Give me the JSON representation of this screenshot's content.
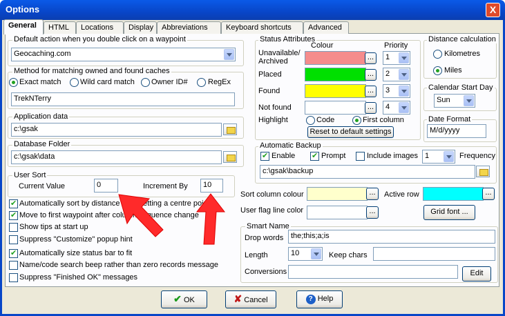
{
  "window": {
    "title": "Options",
    "close": "X"
  },
  "tabs": [
    "General",
    "HTML",
    "Locations",
    "Display",
    "Abbreviations",
    "Keyboard shortcuts",
    "Advanced"
  ],
  "default_action": {
    "label": "Default action when you double click on a waypoint",
    "value": "Geocaching.com"
  },
  "matching": {
    "label": "Method for matching owned and found caches",
    "options": [
      "Exact match",
      "Wild card match",
      "Owner ID#",
      "RegEx"
    ],
    "selected": "Exact match",
    "value": "TrekNTerry"
  },
  "app_data": {
    "label": "Application data",
    "value": "c:\\gsak"
  },
  "db_folder": {
    "label": "Database Folder",
    "value": "c:\\gsak\\data"
  },
  "user_sort": {
    "label": "User Sort",
    "current_label": "Current Value",
    "current": "0",
    "increment_label": "Increment By",
    "increment": "10"
  },
  "checks": [
    {
      "label": "Automatically sort by distance after setting a centre point",
      "checked": true
    },
    {
      "label": "Move to first waypoint after column sequence change",
      "checked": true
    },
    {
      "label": "Show tips at start up",
      "checked": false
    },
    {
      "label": "Suppress \"Customize\" popup hint",
      "checked": false
    },
    {
      "label": "Automatically size status bar to fit",
      "checked": true
    },
    {
      "label": "Name/code search beep rather than zero records message",
      "checked": false
    },
    {
      "label": "Suppress \"Finished OK\" messages",
      "checked": false
    }
  ],
  "status": {
    "label": "Status Attributes",
    "colour_label": "Colour",
    "priority_label": "Priority",
    "rows": [
      {
        "label": "Unavailable/ Archived",
        "color": "#f58c8c",
        "priority": "1"
      },
      {
        "label": "Placed",
        "color": "#00e000",
        "priority": "2"
      },
      {
        "label": "Found",
        "color": "#ffff00",
        "priority": "3"
      },
      {
        "label": "Not found",
        "color": "#ffffff",
        "priority": "4"
      }
    ],
    "highlight_label": "Highlight",
    "highlight_options": [
      "Code",
      "First column"
    ],
    "highlight_selected": "First column",
    "reset": "Reset to default settings",
    "dots": "..."
  },
  "distance": {
    "label": "Distance calculation",
    "options": [
      "Kilometres",
      "Miles"
    ],
    "selected": "Miles"
  },
  "calendar": {
    "label": "Calendar Start Day",
    "value": "Sun"
  },
  "date_format": {
    "label": "Date Format",
    "value": "M/d/yyyy"
  },
  "backup": {
    "label": "Automatic Backup",
    "enable": "Enable",
    "prompt": "Prompt",
    "include_images": "Include images",
    "frequency_value": "1",
    "frequency_label": "Frequency",
    "path": "c:\\gsak\\backup"
  },
  "sort_colour": {
    "label": "Sort column colour",
    "color": "#ffffcc"
  },
  "active_row": {
    "label": "Active row",
    "color": "#00ffff"
  },
  "flag_color": {
    "label": "User flag line color",
    "color": "#ffffff"
  },
  "grid_font": "Grid font ...",
  "smart_name": {
    "label": "Smart Name",
    "drop_label": "Drop words",
    "drop": "the;this;a;is",
    "length_label": "Length",
    "length": "10",
    "keep_label": "Keep chars",
    "keep": "",
    "conv_label": "Conversions",
    "conv": "",
    "edit": "Edit"
  },
  "buttons": {
    "ok": "OK",
    "cancel": "Cancel",
    "help": "Help"
  },
  "colors": {
    "title_bar": "#0846c8",
    "dialog_bg": "#ece9d8",
    "arrow": "#ff2a2a"
  }
}
